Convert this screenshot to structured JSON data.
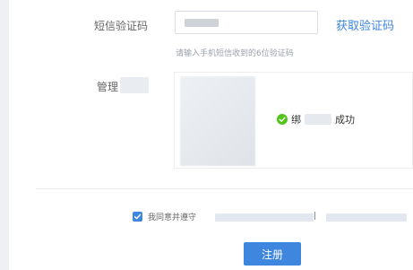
{
  "form": {
    "sms_label": "短信验证码",
    "get_code_label": "获取验证码",
    "hint": "请输入手机短信收到的6位验证码",
    "manager_label": "管理",
    "bind_status": "绑定成功",
    "bind_status_prefix": "绑",
    "bind_status_suffix": "成功",
    "agree_text": "我同意并遵守",
    "terms_separator": "|",
    "register_label": "注册"
  },
  "colors": {
    "accent": "#3f86df",
    "success": "#52c41a",
    "label": "#666666",
    "hint": "#9aa1aa"
  }
}
